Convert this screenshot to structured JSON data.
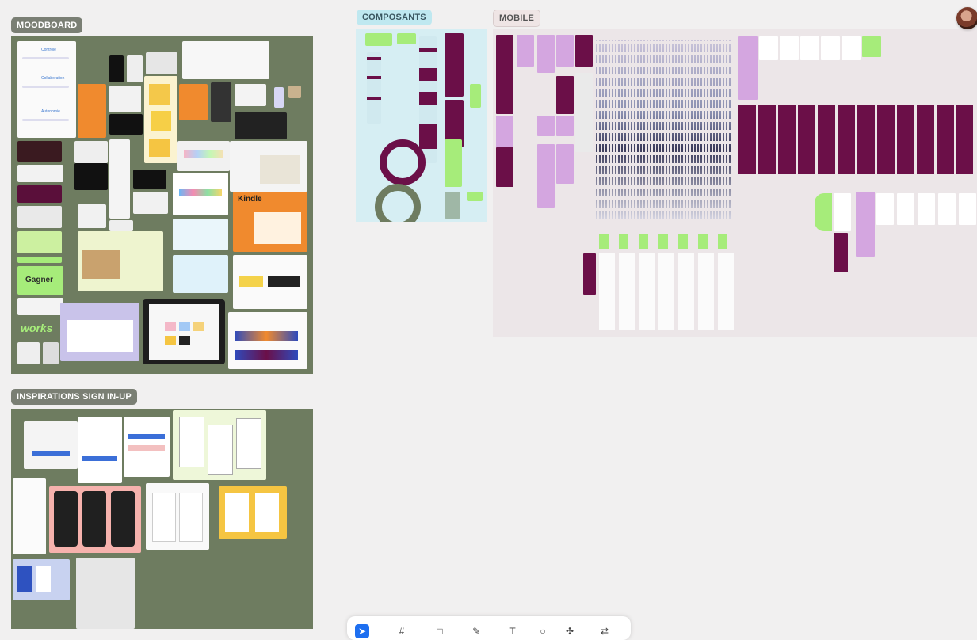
{
  "sections": {
    "moodboard": "MOODBOARD",
    "signin": "INSPIRATIONS SIGN IN-UP",
    "composants": "COMPOSANTS",
    "mobile": "MOBILE"
  },
  "moodboard_texts": {
    "note1": "Contrôlé",
    "note2": "Collaboration",
    "note3": "Autonomie",
    "kindle": "Kindle",
    "gagner": "Gagner",
    "works": "works"
  },
  "colors": {
    "moodboard_bg": "#6e7c60",
    "composants_bg": "#d6eef3",
    "mobile_bg": "#ece6e8",
    "accent_purple": "#6b0f48",
    "accent_green": "#a6ec7a",
    "label_grey": "#7a7f74",
    "label_blue": "#bfe8f0",
    "label_pink": "#efe5e5"
  },
  "toolbar": {
    "tools": [
      "cursor-icon",
      "frame-icon",
      "shape-icon",
      "pen-icon",
      "text-icon",
      "comment-icon",
      "component-icon",
      "share-icon"
    ]
  }
}
